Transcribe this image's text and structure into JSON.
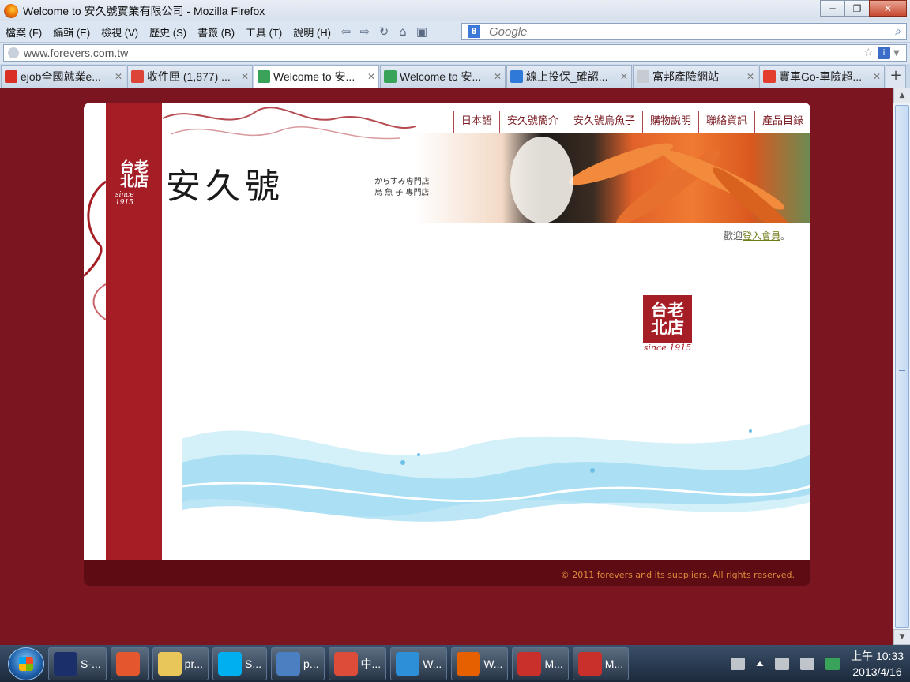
{
  "window": {
    "title": "Welcome to 安久號實業有限公司 - Mozilla Firefox",
    "controls": [
      "─",
      "❐",
      "✕"
    ]
  },
  "menu": [
    "檔案 (F)",
    "編輯 (E)",
    "檢視 (V)",
    "歷史 (S)",
    "書籤 (B)",
    "工具 (T)",
    "說明 (H)"
  ],
  "search": {
    "placeholder": "Google",
    "engine_letter": "8"
  },
  "address": {
    "url": "www.forevers.com.tw"
  },
  "tabs": [
    {
      "label": "ejob全國就業e...",
      "close": "✕",
      "color": "#d93025"
    },
    {
      "label": "收件匣 (1,877) ...",
      "close": "✕",
      "color": "#db4437"
    },
    {
      "label": "Welcome to 安...",
      "close": "✕",
      "color": "#3aa35a"
    },
    {
      "label": "Welcome to 安...",
      "close": "✕",
      "color": "#3aa35a"
    },
    {
      "label": "線上投保_確認...",
      "close": "✕",
      "color": "#2f7ad8"
    },
    {
      "label": "富邦產險網站",
      "close": "✕",
      "color": "#c7ccd3"
    },
    {
      "label": "寶車Go-車險超...",
      "close": "✕",
      "color": "#e23d2d"
    }
  ],
  "site": {
    "nav": [
      "日本語",
      "安久號簡介",
      "安久號烏魚子",
      "購物說明",
      "聯絡資訊",
      "產品目錄"
    ],
    "badge_chars": "台老\n北店",
    "badge_since": "since 1915",
    "brand": "安久號",
    "brand_sub_1": "からすみ専門店",
    "brand_sub_2": "烏 魚 子 專門店",
    "welcome_prefix": "歡迎",
    "welcome_link": "登入會員",
    "welcome_suffix": "。",
    "center_badge_chars": "台老\n北店",
    "center_badge_since": "since 1915",
    "copyright": "© 2011 forevers and its suppliers. All rights reserved."
  },
  "taskbar": {
    "items": [
      {
        "label": "S-...",
        "color": "#1b2f6b"
      },
      {
        "label": "",
        "color": "#e4572e"
      },
      {
        "label": "pr...",
        "color": "#e8c65a"
      },
      {
        "label": "S...",
        "color": "#00aff0"
      },
      {
        "label": "p...",
        "color": "#4a7fc1"
      },
      {
        "label": "中...",
        "color": "#dd4b39"
      },
      {
        "label": "W...",
        "color": "#2c8fd8"
      },
      {
        "label": "W...",
        "color": "#e66000"
      },
      {
        "label": "M...",
        "color": "#c9302c"
      },
      {
        "label": "M...",
        "color": "#c9302c"
      }
    ],
    "time": "上午 10:33",
    "date": "2013/4/16"
  },
  "colors": {
    "page_bg": "#7b1520",
    "brand_red": "#a51e25",
    "footer": "#5e0c14",
    "link_olive": "#6e7a13"
  }
}
